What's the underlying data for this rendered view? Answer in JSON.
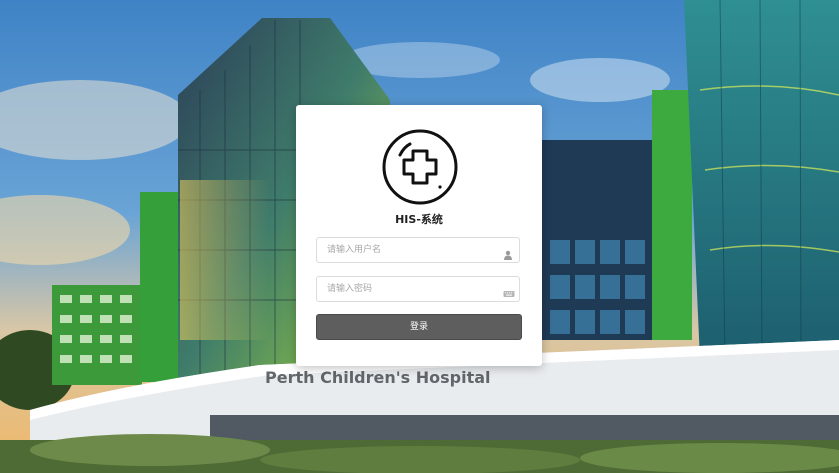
{
  "background": {
    "scene": "hospital-building-photo",
    "sign_text": "Perth Children's Hospital"
  },
  "login": {
    "logo_icon": "medical-cross-icon",
    "title": "HIS-系统",
    "username": {
      "placeholder": "请输入用户名",
      "value": "",
      "icon": "user-icon"
    },
    "password": {
      "placeholder": "请输入密码",
      "value": "",
      "icon": "keyboard-icon"
    },
    "submit_label": "登录"
  },
  "colors": {
    "card": "#ffffff",
    "button": "#5e5e5e",
    "button_text": "#ffffff"
  }
}
